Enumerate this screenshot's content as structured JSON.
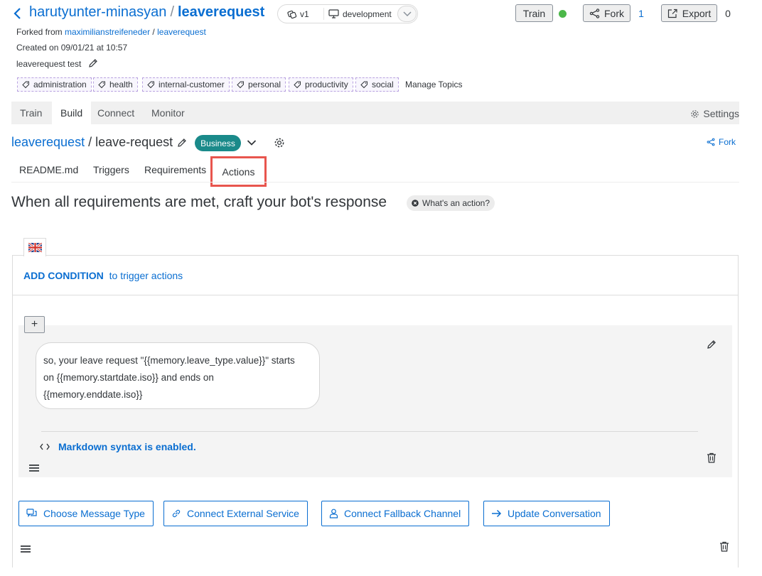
{
  "header": {
    "owner": "harutyunter-minasyan",
    "separator": "/",
    "repo": "leaverequest",
    "version": "v1",
    "environment": "development",
    "train_label": "Train",
    "fork_label": "Fork",
    "fork_count": "1",
    "export_label": "Export",
    "export_count": "0",
    "status_color": "#4cb849"
  },
  "meta": {
    "forked_from_prefix": "Forked from",
    "forked_from_user": "maximilianstreifeneder",
    "forked_from_sep": "/",
    "forked_from_repo": "leaverequest",
    "created": "Created on 09/01/21 at 10:57",
    "description": "leaverequest test"
  },
  "topics": [
    "administration",
    "health",
    "internal-customer",
    "personal",
    "productivity",
    "social"
  ],
  "manage_topics_label": "Manage Topics",
  "main_tabs": [
    "Train",
    "Build",
    "Connect",
    "Monitor"
  ],
  "settings_label": "Settings",
  "skill": {
    "bot": "leaverequest",
    "separator": "/",
    "name": "leave-request",
    "badge": "Business",
    "fork_label": "Fork"
  },
  "skill_tabs": [
    "README.md",
    "Triggers",
    "Requirements",
    "Actions"
  ],
  "heading": "When all requirements are met, craft your bot's response",
  "whats_action_label": "What's an action?",
  "condition": {
    "add_label": "ADD CONDITION",
    "suffix": "to trigger actions"
  },
  "plus_label": "+",
  "message": {
    "line1": "so, your leave request \"{{memory.leave_type.value}}\" starts",
    "line2": "on {{memory.startdate.iso}} and ends on",
    "line3": "{{memory.enddate.iso}}"
  },
  "markdown_note": "Markdown syntax is enabled.",
  "action_buttons": [
    "Choose Message Type",
    "Connect External Service",
    "Connect Fallback Channel",
    "Update Conversation"
  ],
  "colors": {
    "accent": "#0a6ed1",
    "badge": "#1a8a8a",
    "highlight": "#e8554e"
  }
}
